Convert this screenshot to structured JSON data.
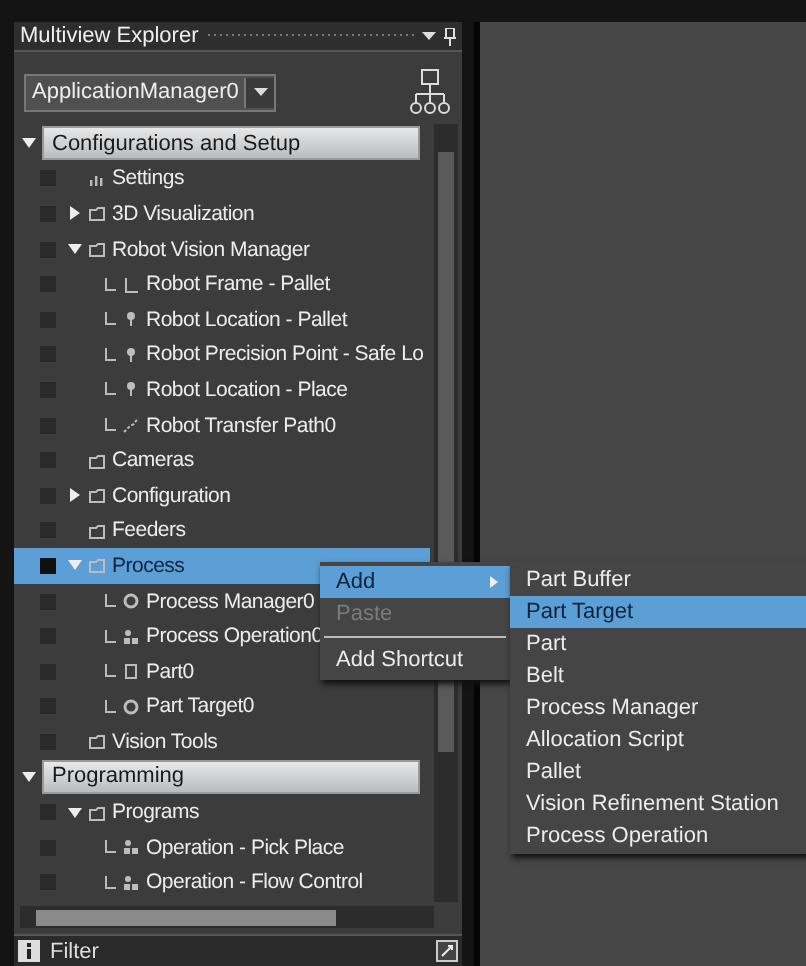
{
  "panel": {
    "title": "Multiview Explorer",
    "selector": "ApplicationManager0"
  },
  "tree": [
    {
      "label": "Configurations and Setup",
      "kind": "section",
      "expanded": true,
      "children": [
        {
          "label": "Settings",
          "kind": "settings",
          "selected": false
        },
        {
          "label": "3D Visualization",
          "kind": "folder",
          "expanded": false,
          "selected": false
        },
        {
          "label": "Robot Vision Manager",
          "kind": "folder",
          "expanded": true,
          "selected": false,
          "children": [
            {
              "label": "Robot Frame - Pallet",
              "kind": "frame",
              "selected": false
            },
            {
              "label": "Robot Location - Pallet",
              "kind": "location",
              "selected": false
            },
            {
              "label": "Robot Precision Point - Safe Lo",
              "kind": "location",
              "selected": false
            },
            {
              "label": "Robot Location - Place",
              "kind": "location",
              "selected": false
            },
            {
              "label": "Robot Transfer Path0",
              "kind": "path",
              "selected": false
            }
          ]
        },
        {
          "label": "Cameras",
          "kind": "folder",
          "selected": false
        },
        {
          "label": "Configuration",
          "kind": "folder",
          "expanded": false,
          "selected": false
        },
        {
          "label": "Feeders",
          "kind": "folder",
          "selected": false
        },
        {
          "label": "Process",
          "kind": "folder",
          "expanded": true,
          "selected": true,
          "children": [
            {
              "label": "Process Manager0",
              "kind": "target",
              "selected": false
            },
            {
              "label": "Process Operation0",
              "kind": "operation",
              "selected": false
            },
            {
              "label": "Part0",
              "kind": "part",
              "selected": false
            },
            {
              "label": "Part Target0",
              "kind": "target",
              "selected": false
            }
          ]
        },
        {
          "label": "Vision Tools",
          "kind": "folder",
          "selected": false
        }
      ]
    },
    {
      "label": "Programming",
      "kind": "section",
      "expanded": true,
      "children": [
        {
          "label": "Programs",
          "kind": "folder",
          "expanded": true,
          "selected": false,
          "children": [
            {
              "label": "Operation - Pick Place",
              "kind": "operation",
              "selected": false
            },
            {
              "label": "Operation - Flow Control",
              "kind": "operation",
              "selected": false
            }
          ]
        }
      ]
    }
  ],
  "filter": {
    "label": "Filter"
  },
  "context_menu": [
    {
      "label": "Add",
      "kind": "submenu",
      "selected": true,
      "disabled": false
    },
    {
      "label": "Paste",
      "kind": "command",
      "selected": false,
      "disabled": true
    },
    {
      "kind": "separator"
    },
    {
      "label": "Add Shortcut",
      "kind": "command",
      "selected": false,
      "disabled": false
    }
  ],
  "submenu": [
    {
      "label": "Part Buffer",
      "selected": false
    },
    {
      "label": "Part Target",
      "selected": true
    },
    {
      "label": "Part",
      "selected": false
    },
    {
      "label": "Belt",
      "selected": false
    },
    {
      "label": "Process Manager",
      "selected": false
    },
    {
      "label": "Allocation Script",
      "selected": false
    },
    {
      "label": "Pallet",
      "selected": false
    },
    {
      "label": "Vision Refinement Station",
      "selected": false
    },
    {
      "label": "Process Operation",
      "selected": false
    }
  ]
}
